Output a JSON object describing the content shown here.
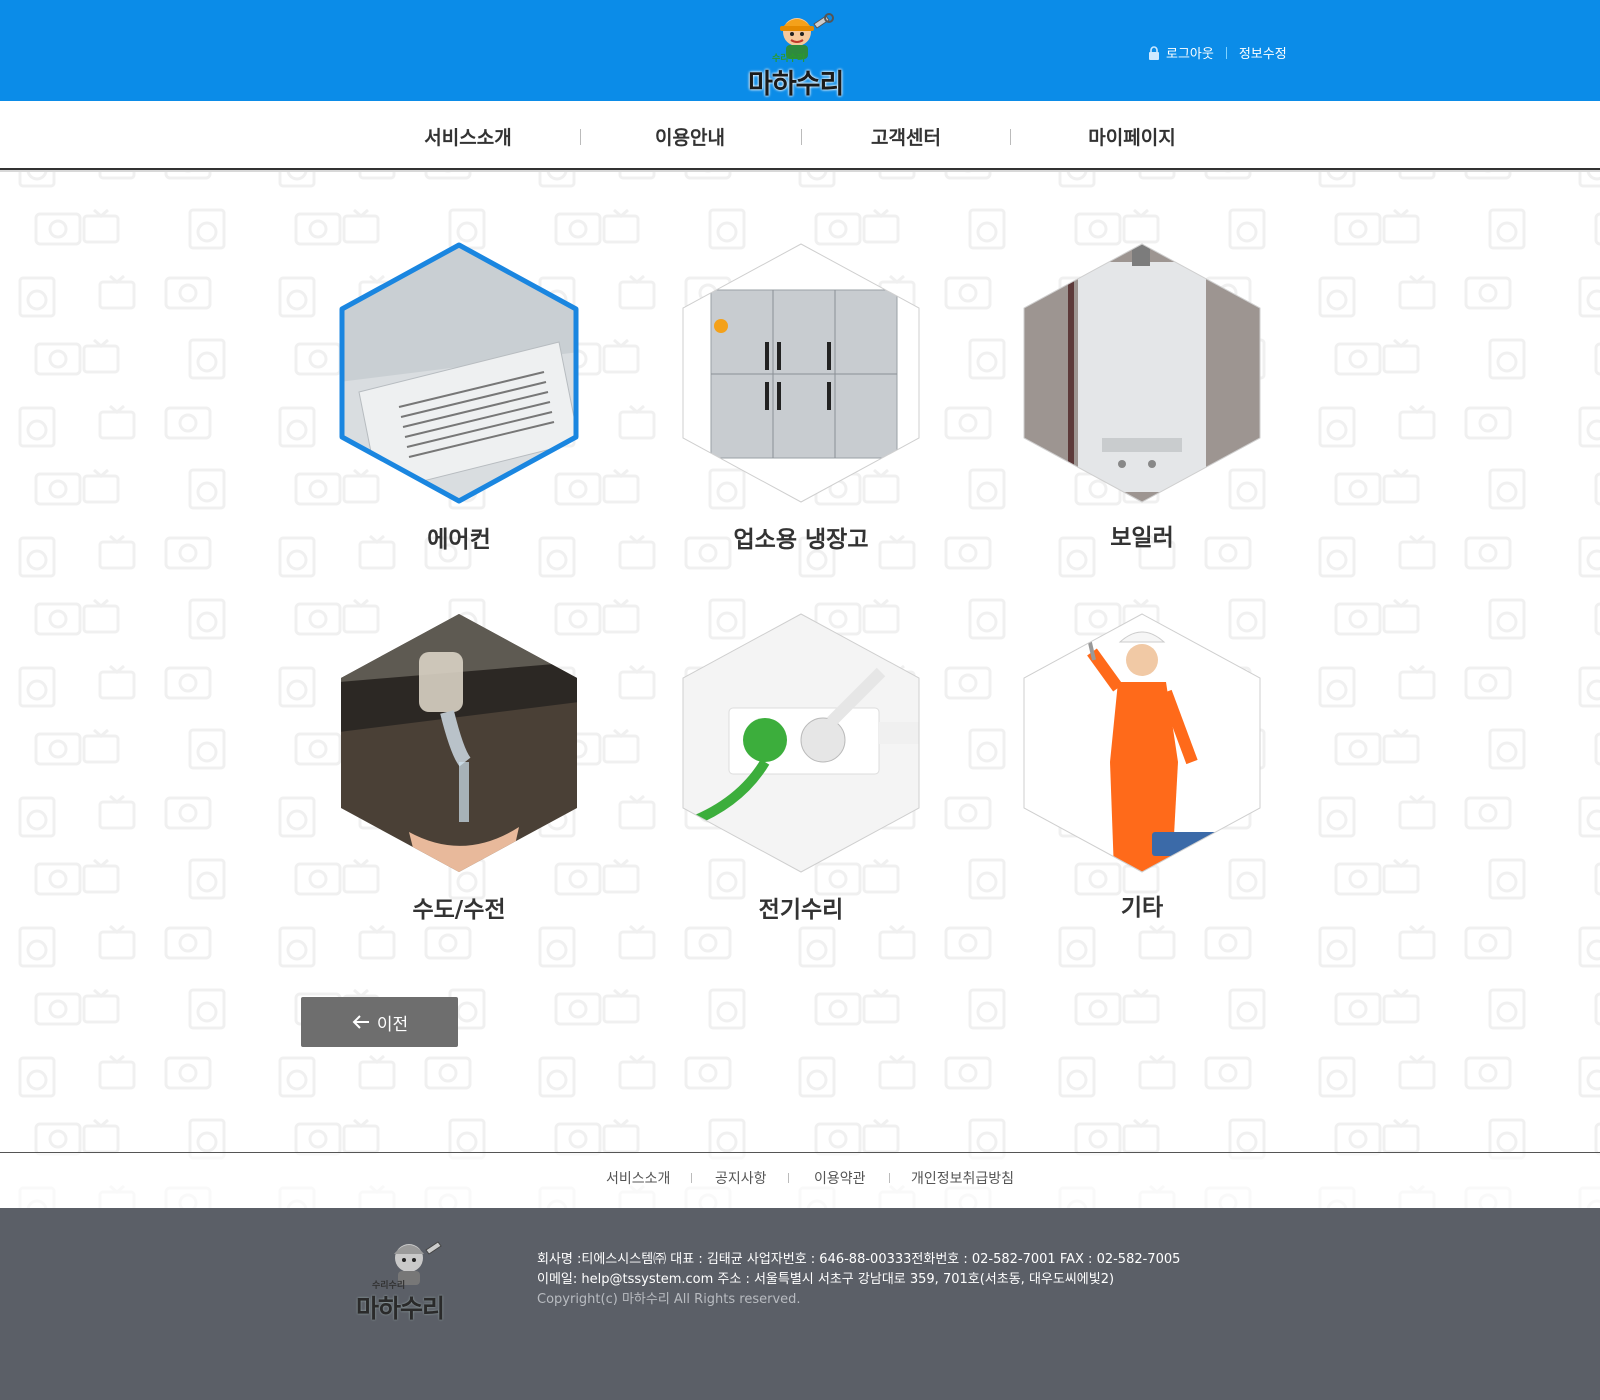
{
  "brand": {
    "logo_text": "마하수리",
    "logo_sub": "수리수리",
    "colors": {
      "header": "#0b8ce8",
      "footer": "#5b5f67",
      "button": "#6e6e6e",
      "selected_border": "#1a86e0"
    }
  },
  "header": {
    "logout": "로그아웃",
    "edit_info": "정보수정",
    "lock_icon": "lock-icon"
  },
  "nav": {
    "items": [
      "서비스소개",
      "이용안내",
      "고객센터",
      "마이페이지"
    ]
  },
  "services": [
    {
      "label": "에어컨",
      "image": "ceiling-air-conditioner",
      "selected": true
    },
    {
      "label": "업소용 냉장고",
      "image": "commercial-refrigerator",
      "selected": false
    },
    {
      "label": "보일러",
      "image": "wall-boiler",
      "selected": false
    },
    {
      "label": "수도/수전",
      "image": "water-faucet",
      "selected": false
    },
    {
      "label": "전기수리",
      "image": "power-strip",
      "selected": false
    },
    {
      "label": "기타",
      "image": "repair-worker",
      "selected": false
    }
  ],
  "prev_button": {
    "label": "이전",
    "icon": "arrow-left-icon"
  },
  "footer_links": [
    "서비스소개",
    "공지사항",
    "이용약관",
    "개인정보취급방침"
  ],
  "footer": {
    "line1": "회사명 :티에스시스템㈜  대표 : 김태균  사업자번호 : 646-88-00333전화번호 : 02-582-7001   FAX : 02-582-7005",
    "line2": "이메일: help@tssystem.com  주소 : 서울특별시 서초구 강남대로 359, 701호(서초동, 대우도씨에빛2)",
    "copyright": "Copyright(c) 마하수리  All Rights reserved."
  }
}
